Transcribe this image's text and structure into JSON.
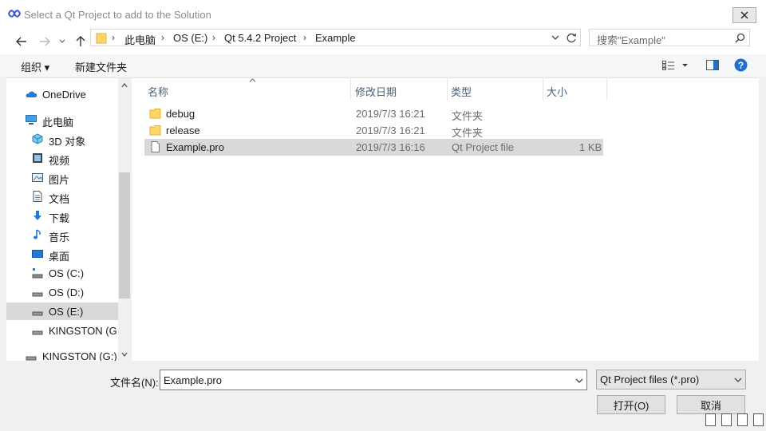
{
  "window": {
    "title": "Select a Qt Project to add to the Solution"
  },
  "address": {
    "crumbs": [
      "此电脑",
      "OS (E:)",
      "Qt 5.4.2 Project",
      "Example"
    ],
    "search_placeholder": "搜索\"Example\""
  },
  "toolbar": {
    "organize": "组织 ▾",
    "new_folder": "新建文件夹"
  },
  "nav": {
    "items": [
      {
        "label": "OneDrive",
        "icon": "cloud-icon"
      },
      {
        "label": "此电脑",
        "icon": "computer-icon"
      },
      {
        "label": "3D 对象",
        "icon": "3d-objects-icon"
      },
      {
        "label": "视频",
        "icon": "video-icon"
      },
      {
        "label": "图片",
        "icon": "pictures-icon"
      },
      {
        "label": "文档",
        "icon": "documents-icon"
      },
      {
        "label": "下载",
        "icon": "download-icon"
      },
      {
        "label": "音乐",
        "icon": "music-icon"
      },
      {
        "label": "桌面",
        "icon": "desktop-icon"
      },
      {
        "label": "OS (C:)",
        "icon": "drive-c-icon"
      },
      {
        "label": "OS (D:)",
        "icon": "drive-icon"
      },
      {
        "label": "OS (E:)",
        "icon": "drive-icon"
      },
      {
        "label": "KINGSTON (G:)",
        "icon": "usb-drive-icon"
      },
      {
        "label": "KINGSTON (G:)",
        "icon": "usb-drive-icon"
      }
    ]
  },
  "columns": {
    "name": "名称",
    "date": "修改日期",
    "type": "类型",
    "size": "大小"
  },
  "files": [
    {
      "name": "debug",
      "date": "2019/7/3 16:21",
      "type": "文件夹",
      "size": "",
      "icon": "folder-icon"
    },
    {
      "name": "release",
      "date": "2019/7/3 16:21",
      "type": "文件夹",
      "size": "",
      "icon": "folder-icon"
    },
    {
      "name": "Example.pro",
      "date": "2019/7/3 16:16",
      "type": "Qt Project file",
      "size": "1 KB",
      "icon": "file-icon"
    }
  ],
  "filename": {
    "label": "文件名(N):",
    "value": "Example.pro"
  },
  "filter": {
    "value": "Qt Project files (*.pro)"
  },
  "buttons": {
    "open": "打开(O)",
    "cancel": "取消"
  },
  "colors": {
    "accent": "#0078d7",
    "selection": "#d9d9d9",
    "header_text": "#4c607a"
  }
}
